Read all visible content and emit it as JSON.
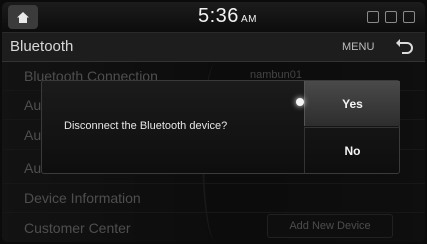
{
  "status": {
    "time": "5:36",
    "ampm": "AM"
  },
  "header": {
    "title": "Bluetooth",
    "menu_label": "MENU"
  },
  "list": {
    "items": [
      "Bluetooth Connection",
      "Au",
      "Au",
      "Au",
      "Device Information",
      "Customer Center"
    ],
    "connected_device": "nambun01",
    "add_device_label": "Add New Device"
  },
  "dialog": {
    "message": "Disconnect the Bluetooth device?",
    "yes_label": "Yes",
    "no_label": "No",
    "selected": "yes"
  },
  "icons": {
    "home": "home-icon",
    "back": "back-arrow-icon"
  }
}
